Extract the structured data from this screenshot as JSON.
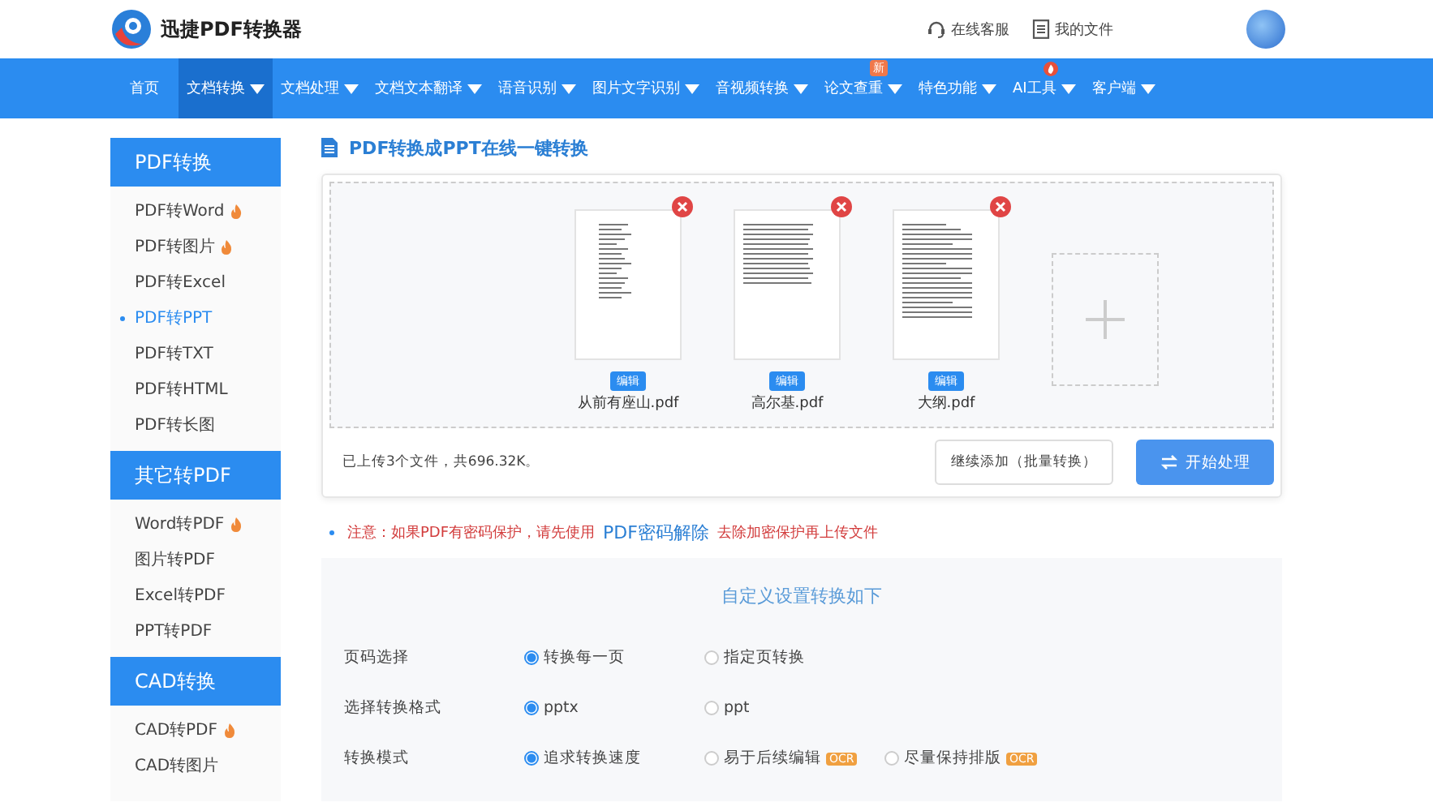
{
  "header": {
    "logo_text": "迅捷PDF转换器",
    "links": [
      {
        "kind": "headset",
        "label": "在线客服"
      },
      {
        "kind": "file",
        "label": "我的文件"
      }
    ]
  },
  "nav": [
    {
      "label": "首页",
      "selected": false,
      "dropdown": false
    },
    {
      "label": "文档转换",
      "selected": true,
      "dropdown": true
    },
    {
      "label": "文档处理",
      "selected": false,
      "dropdown": true
    },
    {
      "label": "文档文本翻译",
      "selected": false,
      "dropdown": true
    },
    {
      "label": "语音识别",
      "selected": false,
      "dropdown": true
    },
    {
      "label": "图片文字识别",
      "selected": false,
      "dropdown": true
    },
    {
      "label": "音视频转换",
      "selected": false,
      "dropdown": true
    },
    {
      "label": "论文查重",
      "selected": false,
      "dropdown": true,
      "badge": "新"
    },
    {
      "label": "特色功能",
      "selected": false,
      "dropdown": true
    },
    {
      "label": "AI工具",
      "selected": false,
      "dropdown": true,
      "badge_icon": true
    },
    {
      "label": "客户端",
      "selected": false,
      "dropdown": true
    }
  ],
  "sidebar": [
    {
      "title": "PDF转换",
      "items": [
        {
          "label": "PDF转Word",
          "hot": true,
          "selected": false
        },
        {
          "label": "PDF转图片",
          "hot": true,
          "selected": false
        },
        {
          "label": "PDF转Excel",
          "hot": false,
          "selected": false
        },
        {
          "label": "PDF转PPT",
          "hot": false,
          "selected": true
        },
        {
          "label": "PDF转TXT",
          "hot": false,
          "selected": false
        },
        {
          "label": "PDF转HTML",
          "hot": false,
          "selected": false
        },
        {
          "label": "PDF转长图",
          "hot": false,
          "selected": false
        }
      ]
    },
    {
      "title": "其它转PDF",
      "items": [
        {
          "label": "Word转PDF",
          "hot": true,
          "selected": false
        },
        {
          "label": "图片转PDF",
          "hot": false,
          "selected": false
        },
        {
          "label": "Excel转PDF",
          "hot": false,
          "selected": false
        },
        {
          "label": "PPT转PDF",
          "hot": false,
          "selected": false
        }
      ]
    },
    {
      "title": "CAD转换",
      "items": [
        {
          "label": "CAD转PDF",
          "hot": true,
          "selected": false
        },
        {
          "label": "CAD转图片",
          "hot": false,
          "selected": false
        }
      ]
    }
  ],
  "main": {
    "title": "PDF转换成PPT在线一键转换",
    "files": [
      {
        "name": "从前有座山.pdf",
        "edit": "编辑",
        "kind": "list"
      },
      {
        "name": "高尔基.pdf",
        "edit": "编辑",
        "kind": "prose"
      },
      {
        "name": "大纲.pdf",
        "edit": "编辑",
        "kind": "outline"
      }
    ],
    "summary": "已上传3个文件，共696.32K。",
    "add_more": "继续添加（批量转换）",
    "start": "开始处理",
    "notice": {
      "before": "注意：如果PDF有密码保护，请先使用",
      "link": "PDF密码解除",
      "after": "去除加密保护再上传文件"
    },
    "settings": {
      "title": "自定义设置转换如下",
      "rows": [
        {
          "label": "页码选择",
          "options": [
            {
              "label": "转换每一页",
              "selected": true
            },
            {
              "label": "指定页转换",
              "selected": false
            }
          ]
        },
        {
          "label": "选择转换格式",
          "options": [
            {
              "label": "pptx",
              "selected": true
            },
            {
              "label": "ppt",
              "selected": false
            }
          ]
        },
        {
          "label": "转换模式",
          "options": [
            {
              "label": "追求转换速度",
              "selected": true
            },
            {
              "label": "易于后续编辑",
              "selected": false,
              "badge": "OCR"
            },
            {
              "label": "尽量保持排版",
              "selected": false,
              "badge": "OCR"
            }
          ]
        }
      ]
    }
  }
}
